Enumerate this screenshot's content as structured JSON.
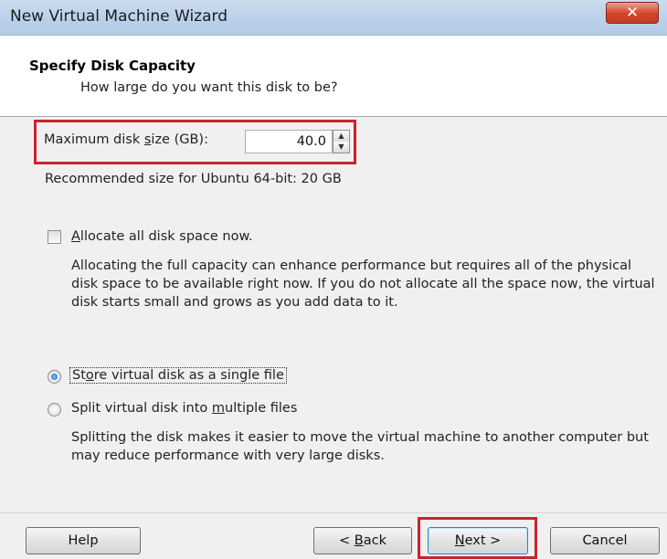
{
  "window": {
    "title": "New Virtual Machine Wizard",
    "close_label": "✕"
  },
  "header": {
    "title": "Specify Disk Capacity",
    "subtitle": "How large do you want this disk to be?"
  },
  "disk_size": {
    "label_prefix": "Maximum disk ",
    "label_underlined": "s",
    "label_suffix": "ize (GB):",
    "value": "40.0",
    "recommended": "Recommended size for Ubuntu 64-bit: 20 GB"
  },
  "allocate": {
    "checked": false,
    "label_underlined": "A",
    "label_rest": "llocate all disk space now.",
    "description": "Allocating the full capacity can enhance performance but requires all of the physical disk space to be available right now. If you do not allocate all the space now, the virtual disk starts small and grows as you add data to it."
  },
  "storage": {
    "single": {
      "selected": true,
      "label_pre": "St",
      "label_underlined": "o",
      "label_post": "re virtual disk as a single file"
    },
    "multiple": {
      "selected": false,
      "label_pre": "Split virtual disk into ",
      "label_underlined": "m",
      "label_post": "ultiple files"
    },
    "description": "Splitting the disk makes it easier to move the virtual machine to another computer but may reduce performance with very large disks."
  },
  "buttons": {
    "help": "Help",
    "back_prefix": "< ",
    "back_underlined": "B",
    "back_suffix": "ack",
    "next_underlined": "N",
    "next_suffix": "ext >",
    "cancel": "Cancel"
  },
  "colors": {
    "highlight_red": "#c8232e",
    "titlebar": "#b9d0ea",
    "radio_dot": "#1a64c8"
  }
}
